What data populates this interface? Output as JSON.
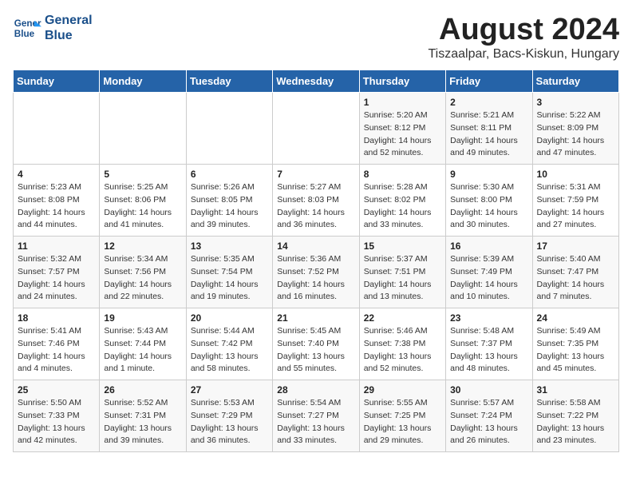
{
  "header": {
    "logo_line1": "General",
    "logo_line2": "Blue",
    "month_year": "August 2024",
    "location": "Tiszaalpar, Bacs-Kiskun, Hungary"
  },
  "days_of_week": [
    "Sunday",
    "Monday",
    "Tuesday",
    "Wednesday",
    "Thursday",
    "Friday",
    "Saturday"
  ],
  "weeks": [
    [
      {
        "day": "",
        "info": ""
      },
      {
        "day": "",
        "info": ""
      },
      {
        "day": "",
        "info": ""
      },
      {
        "day": "",
        "info": ""
      },
      {
        "day": "1",
        "info": "Sunrise: 5:20 AM\nSunset: 8:12 PM\nDaylight: 14 hours\nand 52 minutes."
      },
      {
        "day": "2",
        "info": "Sunrise: 5:21 AM\nSunset: 8:11 PM\nDaylight: 14 hours\nand 49 minutes."
      },
      {
        "day": "3",
        "info": "Sunrise: 5:22 AM\nSunset: 8:09 PM\nDaylight: 14 hours\nand 47 minutes."
      }
    ],
    [
      {
        "day": "4",
        "info": "Sunrise: 5:23 AM\nSunset: 8:08 PM\nDaylight: 14 hours\nand 44 minutes."
      },
      {
        "day": "5",
        "info": "Sunrise: 5:25 AM\nSunset: 8:06 PM\nDaylight: 14 hours\nand 41 minutes."
      },
      {
        "day": "6",
        "info": "Sunrise: 5:26 AM\nSunset: 8:05 PM\nDaylight: 14 hours\nand 39 minutes."
      },
      {
        "day": "7",
        "info": "Sunrise: 5:27 AM\nSunset: 8:03 PM\nDaylight: 14 hours\nand 36 minutes."
      },
      {
        "day": "8",
        "info": "Sunrise: 5:28 AM\nSunset: 8:02 PM\nDaylight: 14 hours\nand 33 minutes."
      },
      {
        "day": "9",
        "info": "Sunrise: 5:30 AM\nSunset: 8:00 PM\nDaylight: 14 hours\nand 30 minutes."
      },
      {
        "day": "10",
        "info": "Sunrise: 5:31 AM\nSunset: 7:59 PM\nDaylight: 14 hours\nand 27 minutes."
      }
    ],
    [
      {
        "day": "11",
        "info": "Sunrise: 5:32 AM\nSunset: 7:57 PM\nDaylight: 14 hours\nand 24 minutes."
      },
      {
        "day": "12",
        "info": "Sunrise: 5:34 AM\nSunset: 7:56 PM\nDaylight: 14 hours\nand 22 minutes."
      },
      {
        "day": "13",
        "info": "Sunrise: 5:35 AM\nSunset: 7:54 PM\nDaylight: 14 hours\nand 19 minutes."
      },
      {
        "day": "14",
        "info": "Sunrise: 5:36 AM\nSunset: 7:52 PM\nDaylight: 14 hours\nand 16 minutes."
      },
      {
        "day": "15",
        "info": "Sunrise: 5:37 AM\nSunset: 7:51 PM\nDaylight: 14 hours\nand 13 minutes."
      },
      {
        "day": "16",
        "info": "Sunrise: 5:39 AM\nSunset: 7:49 PM\nDaylight: 14 hours\nand 10 minutes."
      },
      {
        "day": "17",
        "info": "Sunrise: 5:40 AM\nSunset: 7:47 PM\nDaylight: 14 hours\nand 7 minutes."
      }
    ],
    [
      {
        "day": "18",
        "info": "Sunrise: 5:41 AM\nSunset: 7:46 PM\nDaylight: 14 hours\nand 4 minutes."
      },
      {
        "day": "19",
        "info": "Sunrise: 5:43 AM\nSunset: 7:44 PM\nDaylight: 14 hours\nand 1 minute."
      },
      {
        "day": "20",
        "info": "Sunrise: 5:44 AM\nSunset: 7:42 PM\nDaylight: 13 hours\nand 58 minutes."
      },
      {
        "day": "21",
        "info": "Sunrise: 5:45 AM\nSunset: 7:40 PM\nDaylight: 13 hours\nand 55 minutes."
      },
      {
        "day": "22",
        "info": "Sunrise: 5:46 AM\nSunset: 7:38 PM\nDaylight: 13 hours\nand 52 minutes."
      },
      {
        "day": "23",
        "info": "Sunrise: 5:48 AM\nSunset: 7:37 PM\nDaylight: 13 hours\nand 48 minutes."
      },
      {
        "day": "24",
        "info": "Sunrise: 5:49 AM\nSunset: 7:35 PM\nDaylight: 13 hours\nand 45 minutes."
      }
    ],
    [
      {
        "day": "25",
        "info": "Sunrise: 5:50 AM\nSunset: 7:33 PM\nDaylight: 13 hours\nand 42 minutes."
      },
      {
        "day": "26",
        "info": "Sunrise: 5:52 AM\nSunset: 7:31 PM\nDaylight: 13 hours\nand 39 minutes."
      },
      {
        "day": "27",
        "info": "Sunrise: 5:53 AM\nSunset: 7:29 PM\nDaylight: 13 hours\nand 36 minutes."
      },
      {
        "day": "28",
        "info": "Sunrise: 5:54 AM\nSunset: 7:27 PM\nDaylight: 13 hours\nand 33 minutes."
      },
      {
        "day": "29",
        "info": "Sunrise: 5:55 AM\nSunset: 7:25 PM\nDaylight: 13 hours\nand 29 minutes."
      },
      {
        "day": "30",
        "info": "Sunrise: 5:57 AM\nSunset: 7:24 PM\nDaylight: 13 hours\nand 26 minutes."
      },
      {
        "day": "31",
        "info": "Sunrise: 5:58 AM\nSunset: 7:22 PM\nDaylight: 13 hours\nand 23 minutes."
      }
    ]
  ]
}
